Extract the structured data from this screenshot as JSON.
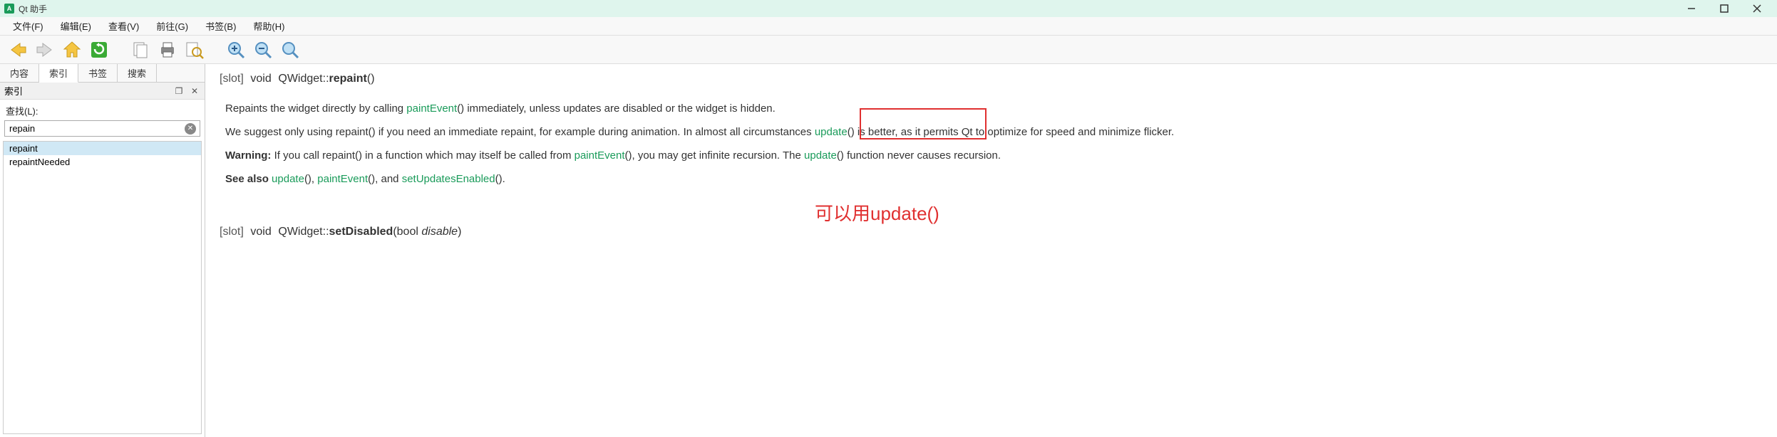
{
  "window": {
    "title": "Qt 助手",
    "icon_label": "A"
  },
  "menu": {
    "file": "文件(F)",
    "edit": "编辑(E)",
    "view": "查看(V)",
    "go": "前往(G)",
    "bookmarks": "书签(B)",
    "help": "帮助(H)"
  },
  "sidebar": {
    "tabs": {
      "content": "内容",
      "index": "索引",
      "bookmarks": "书签",
      "search": "搜索"
    },
    "panel_title": "索引",
    "find_label": "查找(L):",
    "find_value": "repain",
    "results": [
      "repaint",
      "repaintNeeded"
    ]
  },
  "doc": {
    "sig1_slot": "[slot]",
    "sig1_ret": "void",
    "sig1_cls": "QWidget::",
    "sig1_fn": "repaint",
    "sig1_args": "()",
    "p1_a": "Repaints the widget directly by calling ",
    "p1_link": "paintEvent",
    "p1_b": "() immediately, unless updates are disabled or the widget is hidden.",
    "p2_a": "We suggest only using repaint() if you need an immediate repaint, for example during animation. In almost all circumstances ",
    "p2_link": "update",
    "p2_b": "() is better, as it permits Qt to optimize for speed and minimize flicker.",
    "p3_warn": "Warning:",
    "p3_a": " If you call repaint() in a function which may itself be called from ",
    "p3_link1": "paintEvent",
    "p3_b": "(), you may get infinite recursion. The ",
    "p3_link2": "update",
    "p3_c": "() function never causes recursion.",
    "p4_a": "See also ",
    "p4_l1": "update",
    "p4_s1": "(), ",
    "p4_l2": "paintEvent",
    "p4_s2": "(), and ",
    "p4_l3": "setUpdatesEnabled",
    "p4_s3": "().",
    "sig2_slot": "[slot]",
    "sig2_ret": "void",
    "sig2_cls": "QWidget::",
    "sig2_fn": "setDisabled",
    "sig2_args_a": "(bool ",
    "sig2_args_b": "disable",
    "sig2_args_c": ")"
  },
  "annotation": {
    "text": "可以用update()"
  }
}
